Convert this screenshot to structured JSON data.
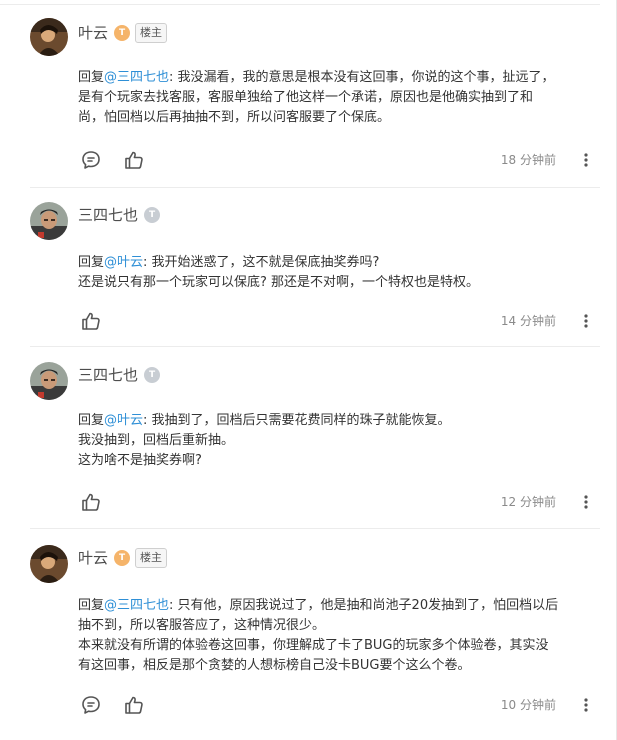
{
  "comments": [
    {
      "username": "叶云",
      "level_icon": "T",
      "badge": "楼主",
      "reply_prefix": "回复",
      "mention": "@三四七也",
      "lines": [
        ": 我没漏看，我的意思是根本没有这回事，你说的这个事，扯远了，",
        "是有个玩家去找客服，客服单独给了他这样一个承诺，原因也是他确实抽到了和",
        "尚，怕回档以后再抽抽不到，所以问客服要了个保底。"
      ],
      "time": "18 分钟前",
      "has_comment_icon": true
    },
    {
      "username": "三四七也",
      "level_icon": "T",
      "badge": "",
      "reply_prefix": "回复",
      "mention": "@叶云",
      "lines": [
        ": 我开始迷惑了，这不就是保底抽奖券吗?",
        "还是说只有那一个玩家可以保底? 那还是不对啊，一个特权也是特权。"
      ],
      "time": "14 分钟前",
      "has_comment_icon": false
    },
    {
      "username": "三四七也",
      "level_icon": "T",
      "badge": "",
      "reply_prefix": "回复",
      "mention": "@叶云",
      "lines": [
        ": 我抽到了，回档后只需要花费同样的珠子就能恢复。",
        "我没抽到，回档后重新抽。",
        "这为啥不是抽奖券啊?"
      ],
      "time": "12 分钟前",
      "has_comment_icon": false
    },
    {
      "username": "叶云",
      "level_icon": "T",
      "badge": "楼主",
      "reply_prefix": "回复",
      "mention": "@三四七也",
      "lines": [
        ": 只有他，原因我说过了，他是抽和尚池子20发抽到了，怕回档以后",
        "抽不到，所以客服答应了，这种情况很少。",
        "本来就没有所谓的体验卷这回事，你理解成了卡了BUG的玩家多个体验卷，其实没",
        "有这回事，相反是那个贪婪的人想标榜自己没卡BUG要个这么个卷。"
      ],
      "time": "10 分钟前",
      "has_comment_icon": true
    }
  ],
  "icons": {
    "comment": "comment-bubble-icon",
    "like": "thumbs-up-icon",
    "more": "more-vertical-icon"
  },
  "colors": {
    "mention": "#2e8fd6",
    "text": "#333333",
    "username": "#4d4d4d",
    "time": "#8a8a8a",
    "level_gold": "#f5b46a",
    "level_grey": "#c8cdd3"
  }
}
